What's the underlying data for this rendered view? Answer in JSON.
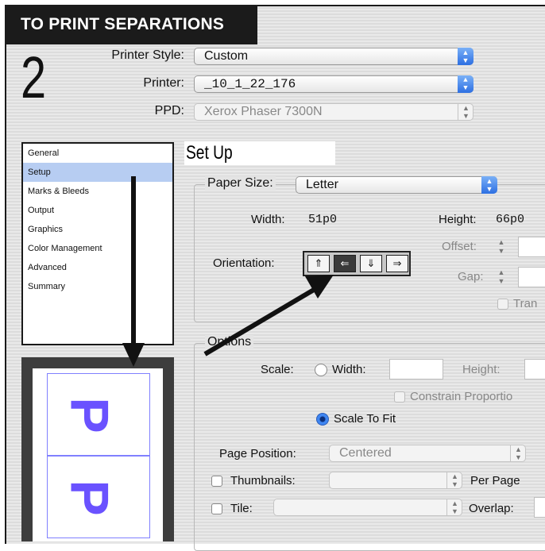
{
  "banner": "TO PRINT SEPARATIONS",
  "step_number": "2",
  "header": {
    "printer_style_label": "Printer Style:",
    "printer_style_value": "Custom",
    "printer_label": "Printer:",
    "printer_value": "_10_1_22_176",
    "ppd_label": "PPD:",
    "ppd_value": "Xerox Phaser 7300N"
  },
  "sidebar": {
    "items": [
      {
        "label": "General"
      },
      {
        "label": "Setup"
      },
      {
        "label": "Marks & Bleeds"
      },
      {
        "label": "Output"
      },
      {
        "label": "Graphics"
      },
      {
        "label": "Color Management"
      },
      {
        "label": "Advanced"
      },
      {
        "label": "Summary"
      }
    ],
    "selected": "Setup"
  },
  "preview": {
    "page_letter": "P"
  },
  "setup": {
    "title": "Set Up",
    "paper_size_label": "Paper Size:",
    "paper_size_value": "Letter",
    "width_label": "Width:",
    "width_value": "51p0",
    "height_label": "Height:",
    "height_value": "66p0",
    "offset_label": "Offset:",
    "gap_label": "Gap:",
    "transverse_label": "Tran",
    "orientation_label": "Orientation:"
  },
  "options": {
    "title": "Options",
    "scale_label": "Scale:",
    "width_radio_label": "Width:",
    "height_label": "Height:",
    "constrain_label": "Constrain Proportio",
    "scale_to_fit_label": "Scale To Fit",
    "page_position_label": "Page Position:",
    "page_position_value": "Centered",
    "thumbnails_label": "Thumbnails:",
    "per_page_label": "Per Page",
    "tile_label": "Tile:",
    "overlap_label": "Overlap:"
  },
  "colors": {
    "selection": "#b7cdf2",
    "popup_accent": "#2d6fe2",
    "glyph": "#6a52ff"
  }
}
